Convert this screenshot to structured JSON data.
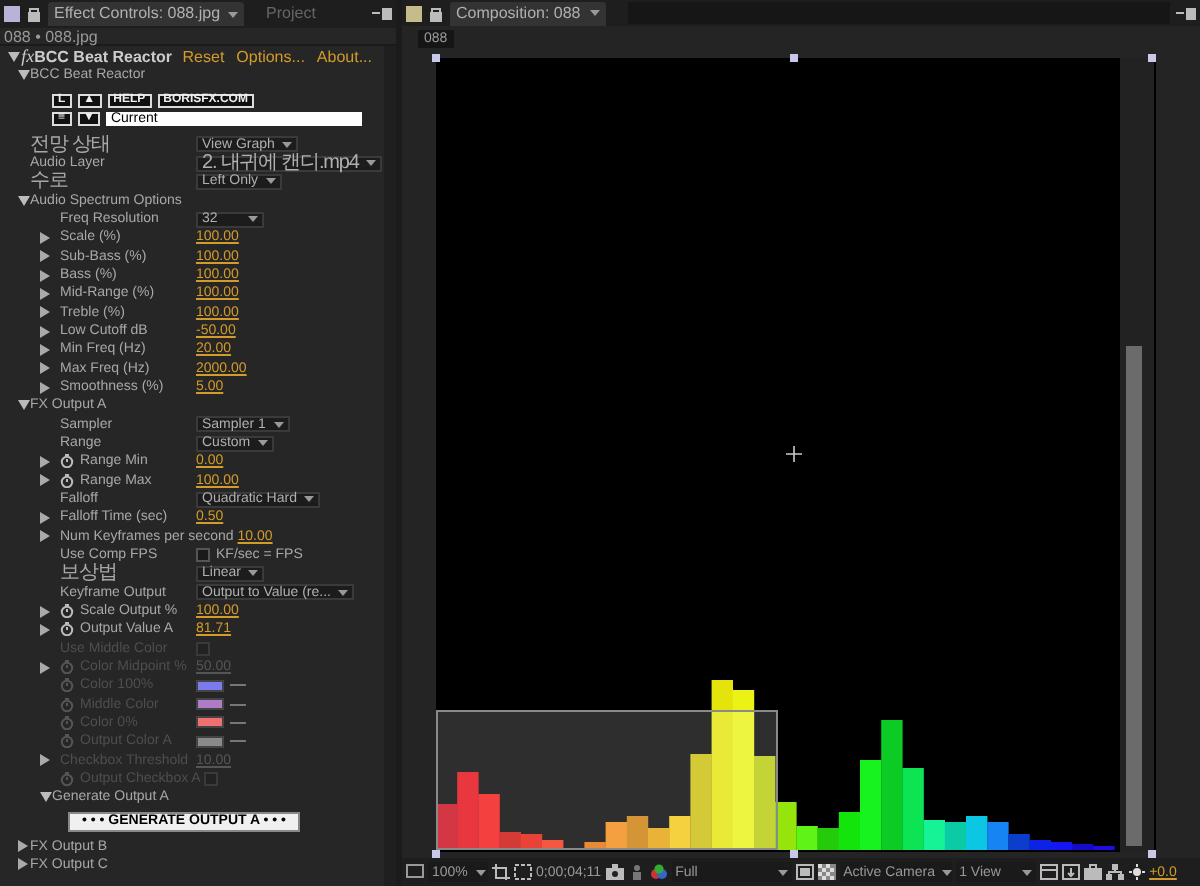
{
  "left_panel": {
    "tabs": [
      {
        "label": "Effect Controls: 088.jpg",
        "selected": true
      },
      {
        "label": "Project",
        "selected": false
      }
    ],
    "breadcrumb": "088 • 088.jpg",
    "effect": {
      "badge": "fx",
      "name": "BCC Beat Reactor",
      "links": [
        "Reset",
        "Options...",
        "About..."
      ]
    },
    "properties": [
      {
        "kind": "group",
        "label": "BCC Beat Reactor",
        "expanded": true,
        "children": [
          {
            "kind": "preset",
            "buttons": [
              "L",
              "▲",
              "HELP",
              "BORISFX.COM"
            ],
            "buttons_2": [
              "≡",
              "▼"
            ],
            "preset": "Current"
          }
        ]
      },
      {
        "kind": "dropdown",
        "label": "전망 상태",
        "value": "View Graph"
      },
      {
        "kind": "dropdown",
        "label": "Audio Layer",
        "value": "2. 내귀에 캔디.mp4"
      },
      {
        "kind": "dropdown",
        "label": "수로",
        "value": "Left Only"
      },
      {
        "kind": "group",
        "label": "Audio Spectrum Options",
        "expanded": true,
        "children": [
          {
            "kind": "dropdown",
            "label": "Freq Resolution",
            "value": "32"
          },
          {
            "kind": "number",
            "label": "Scale (%)",
            "value": "100.00"
          },
          {
            "kind": "number",
            "label": "Sub-Bass (%)",
            "value": "100.00"
          },
          {
            "kind": "number",
            "label": "Bass (%)",
            "value": "100.00"
          },
          {
            "kind": "number",
            "label": "Mid-Range (%)",
            "value": "100.00"
          },
          {
            "kind": "number",
            "label": "Treble (%)",
            "value": "100.00"
          },
          {
            "kind": "number",
            "label": "Low Cutoff dB",
            "value": "-50.00"
          },
          {
            "kind": "number",
            "label": "Min Freq (Hz)",
            "value": "20.00"
          },
          {
            "kind": "number",
            "label": "Max Freq (Hz)",
            "value": "2000.00"
          },
          {
            "kind": "number",
            "label": "Smoothness (%)",
            "value": "5.00"
          }
        ]
      },
      {
        "kind": "group",
        "label": "FX Output A",
        "expanded": true,
        "children": [
          {
            "kind": "dropdown",
            "label": "Sampler",
            "value": "Sampler 1",
            "disabled": false
          },
          {
            "kind": "dropdown",
            "label": "Range",
            "value": "Custom",
            "disabled": false
          },
          {
            "kind": "number",
            "label": "Range Min",
            "value": "0.00",
            "stopwatch": true,
            "disabled": false
          },
          {
            "kind": "number",
            "label": "Range Max",
            "value": "100.00",
            "stopwatch": true,
            "disabled": false
          },
          {
            "kind": "dropdown",
            "label": "Falloff",
            "value": "Quadratic Hard",
            "disabled": false
          },
          {
            "kind": "number",
            "label": "Falloff Time (sec)",
            "value": "0.50",
            "disabled": false
          },
          {
            "kind": "number",
            "label": "Num Keyframes per second",
            "value": "10.00",
            "disabled": false
          },
          {
            "kind": "checkbox",
            "label": "Use Comp FPS",
            "text": "KF/sec = FPS",
            "checked": false,
            "disabled": false
          },
          {
            "kind": "dropdown",
            "label": "보상법",
            "value": "Linear",
            "disabled": false
          },
          {
            "kind": "dropdown",
            "label": "Keyframe Output",
            "value": "Output to Value (re...",
            "disabled": false
          },
          {
            "kind": "number",
            "label": "Scale Output %",
            "value": "100.00",
            "stopwatch": true,
            "disabled": false
          },
          {
            "kind": "number",
            "label": "Output Value A",
            "value": "81.71",
            "stopwatch": true,
            "disabled": false
          },
          {
            "kind": "checkbox",
            "label": "Use Middle Color",
            "checked": false,
            "disabled": true
          },
          {
            "kind": "number",
            "label": "Color Midpoint %",
            "value": "50.00",
            "stopwatch": true,
            "disabled": true
          },
          {
            "kind": "color",
            "label": "Color 100%",
            "color": "#7b7bef",
            "stopwatch": true,
            "disabled": true
          },
          {
            "kind": "color",
            "label": "Middle Color",
            "color": "#b07cc8",
            "stopwatch": true,
            "disabled": true
          },
          {
            "kind": "color",
            "label": "Color 0%",
            "color": "#f07070",
            "stopwatch": true,
            "disabled": true
          },
          {
            "kind": "color",
            "label": "Output Color A",
            "color": "#8a8a8a",
            "stopwatch": true,
            "disabled": true
          },
          {
            "kind": "number",
            "label": "Checkbox Threshold",
            "value": "10.00",
            "disabled": true
          },
          {
            "kind": "checkbox",
            "label": "Output Checkbox A",
            "checked": false,
            "stopwatch": true,
            "disabled": true
          },
          {
            "kind": "group",
            "label": "Generate Output A",
            "expanded": true,
            "children": [
              {
                "kind": "button",
                "label": "• • • GENERATE OUTPUT A • • •"
              }
            ]
          }
        ]
      },
      {
        "kind": "group",
        "label": "FX Output B",
        "expanded": false
      },
      {
        "kind": "group",
        "label": "FX Output C",
        "expanded": false
      }
    ]
  },
  "composition_panel": {
    "tabs": [
      {
        "label": "Composition: 088",
        "selected": true
      }
    ],
    "breadcrumb": "088",
    "toolbar": {
      "zoom": "100%",
      "timecode": "0;00;04;11",
      "resolution": "Full",
      "camera": "Active Camera",
      "views": "1 View",
      "exposure": "+0.0"
    }
  }
}
